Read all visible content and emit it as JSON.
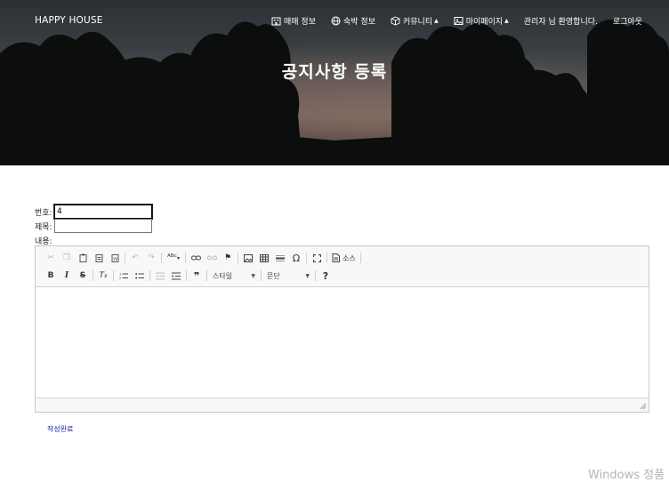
{
  "brand": "HAPPY HOUSE",
  "nav": {
    "items": [
      {
        "label": "매매 정보",
        "icon": "building-icon"
      },
      {
        "label": "숙박 정보",
        "icon": "globe-icon"
      },
      {
        "label": "커뮤니티",
        "icon": "cube-icon",
        "dropdown": true
      },
      {
        "label": "마이페이지",
        "icon": "image-icon",
        "dropdown": true
      }
    ],
    "greeting": "관리자 님 환영합니다.",
    "logout": "로그아웃"
  },
  "hero": {
    "title": "공지사항 등록"
  },
  "form": {
    "number_label": "번호:",
    "number_value": "4",
    "title_label": "제목:",
    "title_value": "",
    "content_label": "내용:"
  },
  "editor": {
    "style_combo": "스타일",
    "format_combo": "문단",
    "source_label": "소스",
    "content": ""
  },
  "submit_label": "작성완료",
  "watermark": "Windows 정품 인"
}
